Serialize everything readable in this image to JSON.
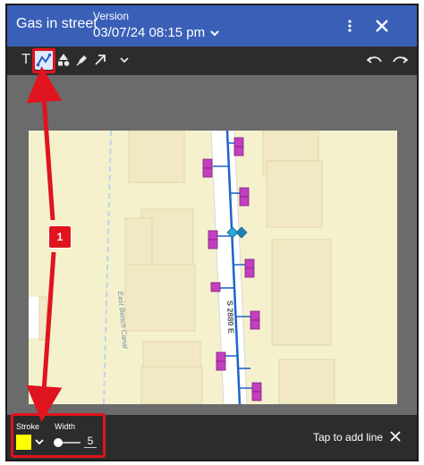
{
  "header": {
    "title": "Gas in street",
    "version_label": "Version",
    "version_value": "03/07/24 08:15 pm"
  },
  "toolbar": {
    "text_glyph": "T",
    "icons": [
      "text-icon",
      "line-icon",
      "shapes-icon",
      "pen-icon",
      "arrow-icon",
      "chevron-down-icon",
      "undo-icon",
      "redo-icon"
    ]
  },
  "map": {
    "street_label": "S 2880 E",
    "canal_label": "East Bench Canal",
    "colors": {
      "background": "#f5f1cd",
      "buildings": "#f2e8c4",
      "street": "#ffffff",
      "main": "#1e64c8",
      "service": "#c23fbf",
      "valve": "#2aa6d9"
    }
  },
  "bottom": {
    "stroke_label": "Stroke",
    "width_label": "Width",
    "stroke_color": "#ffff00",
    "width_value": "5",
    "hint": "Tap to add line"
  },
  "annotation": {
    "badge_number": "1",
    "color": "#e0141e"
  }
}
